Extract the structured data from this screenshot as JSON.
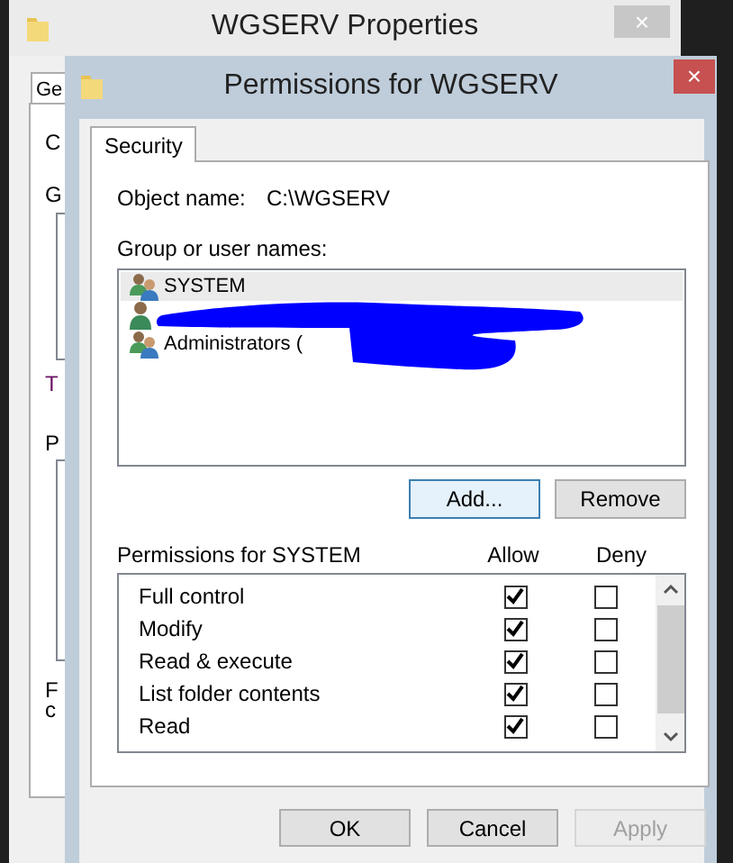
{
  "back_window": {
    "title": "WGSERV Properties",
    "close": "×",
    "tab": "Ge",
    "visible_letters": [
      {
        "text": "C",
        "kind": "label"
      },
      {
        "text": "G",
        "kind": "label"
      },
      {
        "kind": "box"
      },
      {
        "text": "T",
        "kind": "link"
      },
      {
        "text": "P",
        "kind": "label"
      },
      {
        "kind": "box"
      },
      {
        "text": "F",
        "kind": "label"
      },
      {
        "text": "c",
        "kind": "label"
      }
    ]
  },
  "window": {
    "title": "Permissions for WGSERV",
    "close": "×"
  },
  "tabs": [
    {
      "label": "Security",
      "selected": true
    }
  ],
  "object_name": {
    "label": "Object name:",
    "value": "C:\\WGSERV"
  },
  "group_label": "Group or user names:",
  "users": [
    {
      "name": "SYSTEM",
      "kind": "group",
      "selected": true
    },
    {
      "kind": "user",
      "selected": false
    },
    {
      "name": "Administrators (",
      "kind": "group",
      "selected": false
    }
  ],
  "user_buttons": [
    {
      "label": "Add...",
      "focused": true
    },
    {
      "label": "Remove",
      "focused": false
    }
  ],
  "permissions_header": {
    "label": "Permissions for SYSTEM",
    "allow": "Allow",
    "deny": "Deny"
  },
  "permissions": [
    {
      "name": "Full control",
      "allow": true,
      "deny": false
    },
    {
      "name": "Modify",
      "allow": true,
      "deny": false
    },
    {
      "name": "Read & execute",
      "allow": true,
      "deny": false
    },
    {
      "name": "List folder contents",
      "allow": true,
      "deny": false
    },
    {
      "name": "Read",
      "allow": true,
      "deny": false
    }
  ],
  "buttons": [
    {
      "label": "OK",
      "disabled": false
    },
    {
      "label": "Cancel",
      "disabled": false
    },
    {
      "label": "Apply",
      "disabled": true
    }
  ]
}
